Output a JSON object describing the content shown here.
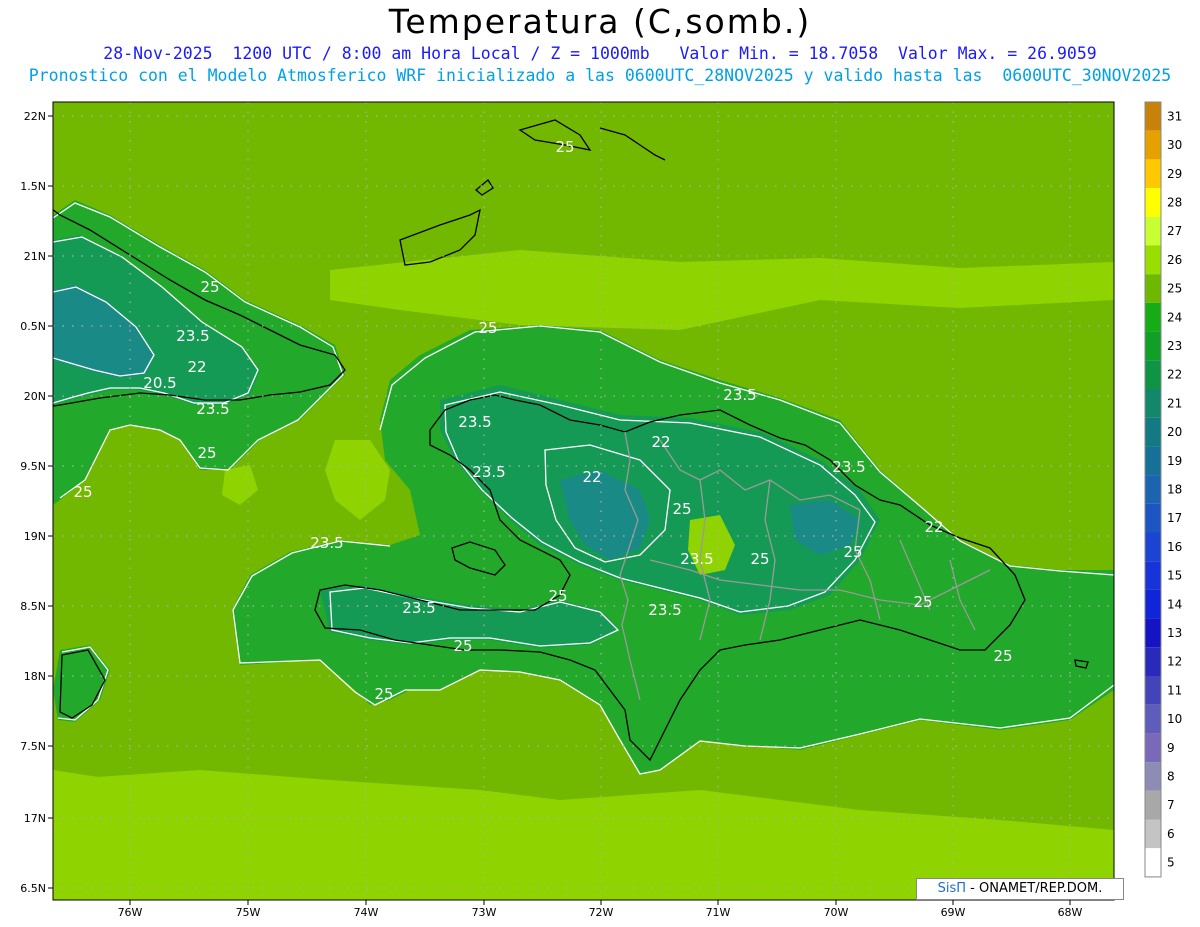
{
  "header": {
    "title": "Temperatura (C,somb.)",
    "subtitle_line1": "28-Nov-2025  1200 UTC / 8:00 am Hora Local / Z = 1000mb   Valor Min. = 18.7058  Valor Max. = 26.9059",
    "subtitle_line2": "Pronostico con el Modelo Atmosferico WRF inicializado a las 0600UTC_28NOV2025 y valido hasta las  0600UTC_30NOV2025"
  },
  "map": {
    "lat_labels": [
      "22N",
      "1.5N",
      "21N",
      "0.5N",
      "20N",
      "9.5N",
      "19N",
      "8.5N",
      "18N",
      "7.5N",
      "17N",
      "6.5N"
    ],
    "lon_labels": [
      "76W",
      "75W",
      "74W",
      "73W",
      "72W",
      "71W",
      "70W",
      "69W",
      "68W"
    ],
    "contour_labels": [
      "25",
      "25",
      "23.5",
      "22",
      "20.5",
      "23.5",
      "25",
      "25",
      "25",
      "23.5",
      "23.5",
      "22",
      "22",
      "23.5",
      "25",
      "23.5",
      "23.5",
      "23.5",
      "25",
      "22",
      "25",
      "23.5",
      "23.5",
      "25",
      "25",
      "25",
      "25",
      "25"
    ],
    "colors": {
      "sea_light": "#8fd400",
      "sea_mid": "#72b800",
      "land_green": "#22a82a",
      "land_dark": "#159a55",
      "land_teal": "#1a8a86",
      "contour": "#ffffff",
      "coast": "#000000",
      "borders": "#9a9a9a",
      "grid_dots": "#b0b0b0"
    }
  },
  "colorbar": {
    "labels": [
      "31",
      "30",
      "29",
      "28",
      "27",
      "26",
      "25",
      "24",
      "23",
      "22",
      "21",
      "20",
      "19",
      "18",
      "17",
      "16",
      "15",
      "14",
      "13",
      "12",
      "11",
      "10",
      "9",
      "8",
      "7",
      "6",
      "5"
    ],
    "colors": [
      "#c8820a",
      "#e6a000",
      "#ffc800",
      "#ffff00",
      "#c8ff32",
      "#9ade00",
      "#6fb800",
      "#16ac16",
      "#10a028",
      "#0e9444",
      "#12876a",
      "#137a84",
      "#167098",
      "#1a64b0",
      "#1c55c4",
      "#1c44d2",
      "#1634d8",
      "#1024d8",
      "#1414c4",
      "#2a2aba",
      "#4444ba",
      "#5e5eba",
      "#7a68b8",
      "#8c8cb4",
      "#a8a8a8",
      "#c4c4c4",
      "#ffffff"
    ]
  },
  "credit": {
    "brand": "SisΠ",
    "text": " - ONAMET/REP.DOM."
  }
}
